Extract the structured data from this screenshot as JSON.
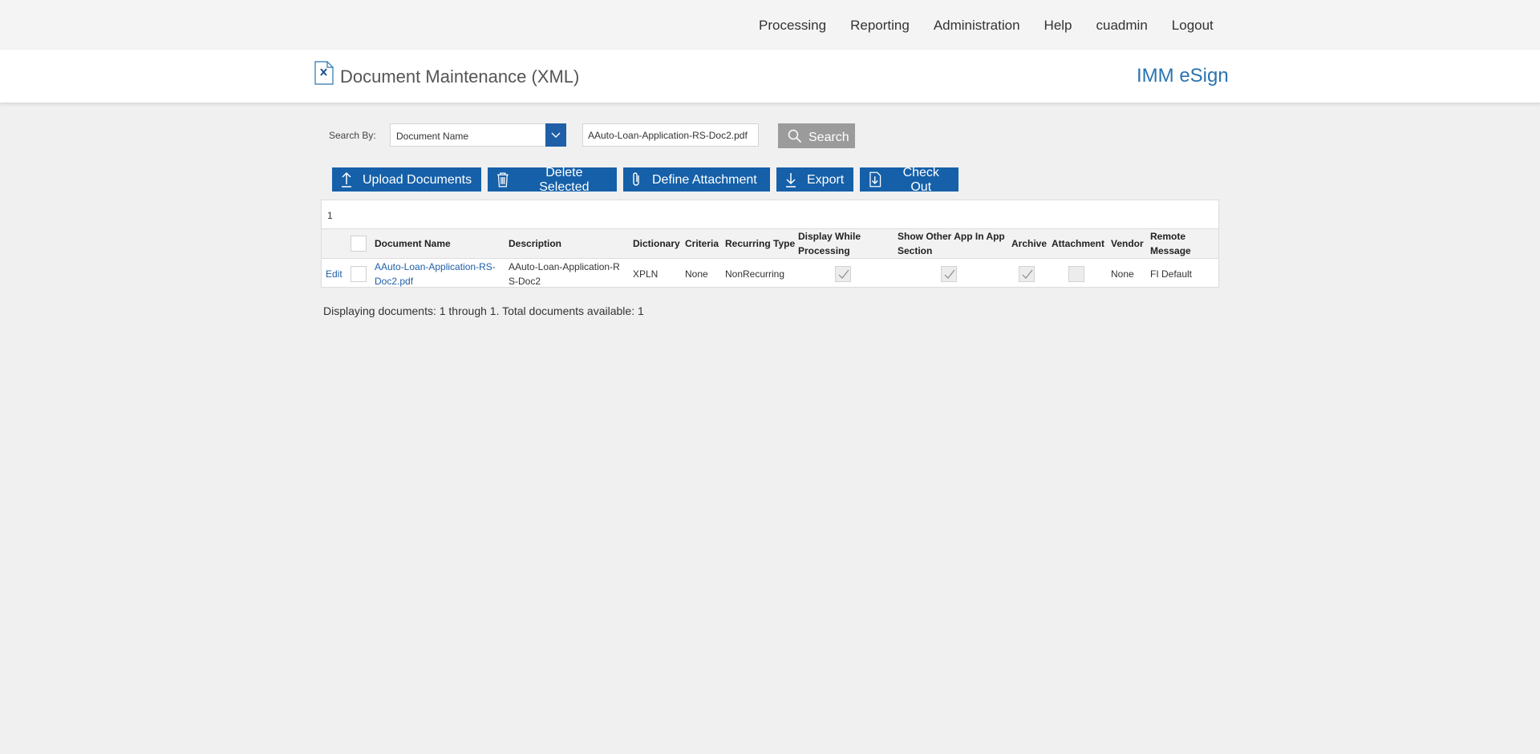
{
  "topnav": {
    "items": [
      "Processing",
      "Reporting",
      "Administration",
      "Help",
      "cuadmin",
      "Logout"
    ]
  },
  "header": {
    "title": "Document Maintenance (XML)",
    "brand": "IMM eSign",
    "icon": "document-xml-icon"
  },
  "search": {
    "label": "Search By:",
    "field_value": "Document Name",
    "input_value": "AAuto-Loan-Application-RS-Doc2.pdf",
    "button_label": "Search"
  },
  "toolbar": {
    "upload_label": "Upload Documents",
    "delete_label": "Delete Selected",
    "define_label": "Define Attachment",
    "export_label": "Export",
    "checkout_label": "Check Out"
  },
  "grid": {
    "page": "1",
    "headers": {
      "document_name": "Document Name",
      "description": "Description",
      "dictionary": "Dictionary",
      "criteria": "Criteria",
      "recurring_type": "Recurring Type",
      "display_while_1": "Display While",
      "display_while_2": "Processing",
      "show_other_1": "Show Other App In App",
      "show_other_2": "Section",
      "archive": "Archive",
      "attachment": "Attachment",
      "vendor": "Vendor",
      "remote_1": "Remote",
      "remote_2": "Message"
    },
    "rows": [
      {
        "edit": "Edit",
        "name_1": "AAuto-Loan-Application-RS-",
        "name_2": "Doc2.pdf",
        "desc_1": "AAuto-Loan-Application-R",
        "desc_2": "S-Doc2",
        "dictionary": "XPLN",
        "criteria": "None",
        "recurring_type": "NonRecurring",
        "display_while_processing": true,
        "show_other_app": true,
        "archive": true,
        "attachment": false,
        "vendor": "None",
        "remote_message": "FI Default"
      }
    ]
  },
  "footer": {
    "status": "Displaying documents: 1 through 1. Total documents available: 1"
  },
  "colors": {
    "primary": "#1560a9",
    "brand": "#2a74b0",
    "search_button": "#9b9b9b"
  }
}
